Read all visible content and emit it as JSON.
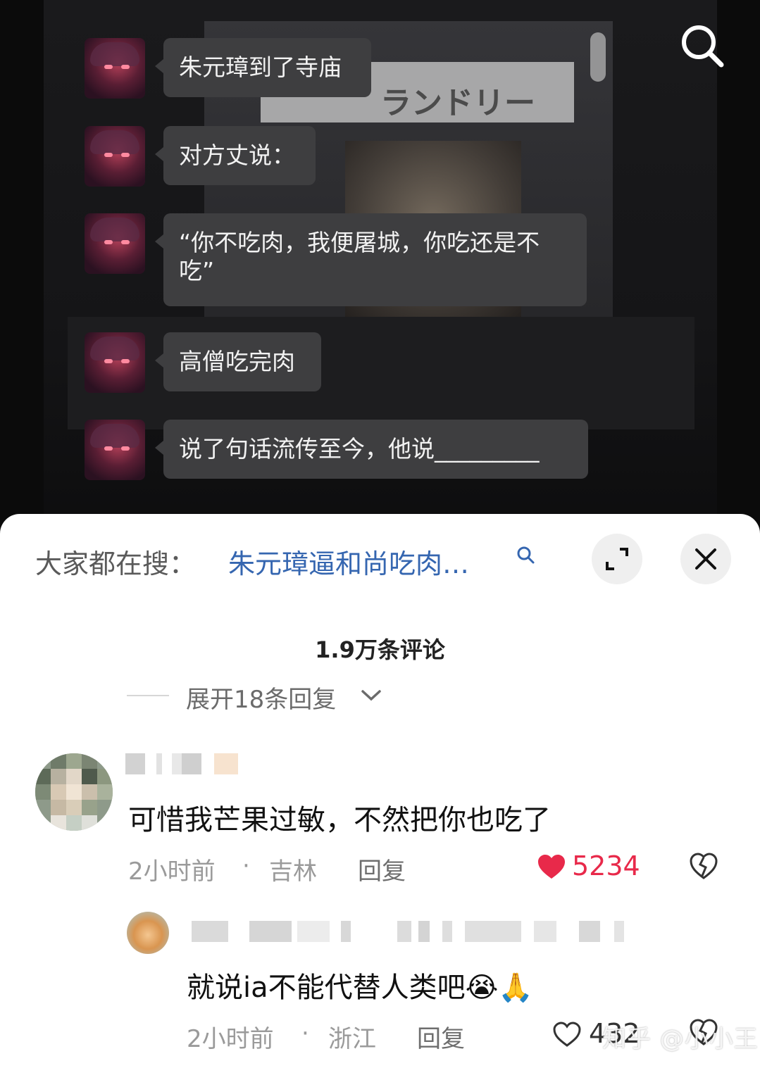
{
  "video": {
    "messages": [
      {
        "text": "朱元璋到了寺庙"
      },
      {
        "text": "对方丈说："
      },
      {
        "text": "“你不吃肉，我便屠城，你吃还是不吃”"
      },
      {
        "text": "高僧吃完肉"
      },
      {
        "text": "说了句话流传至今，他说_________"
      }
    ],
    "sign_text": "ランドリー"
  },
  "sheet": {
    "hot_search_label": "大家都在搜：",
    "hot_search_query": "朱元璋逼和尚吃肉…",
    "comment_count": "1.9万条评论",
    "expand_replies": "展开18条回复",
    "comments": [
      {
        "text": "可惜我芒果过敏，不然把你也吃了",
        "time": "2小时前",
        "location": "吉林",
        "reply_label": "回复",
        "likes": "5234",
        "liked": true
      }
    ],
    "replies": [
      {
        "text": "就说ia不能代替人类吧😭🙏",
        "time": "2小时前",
        "location": "浙江",
        "reply_label": "回复",
        "likes": "432",
        "liked": false
      }
    ],
    "separator": "·"
  },
  "watermark": "知乎 @小小王",
  "colors": {
    "link_blue": "#3566b0",
    "like_red": "#e8294a",
    "bubble": "#3e3e40"
  },
  "icons": [
    "search-icon",
    "expand-icon",
    "close-icon",
    "chevron-down-icon",
    "heart-icon",
    "broken-heart-icon"
  ]
}
